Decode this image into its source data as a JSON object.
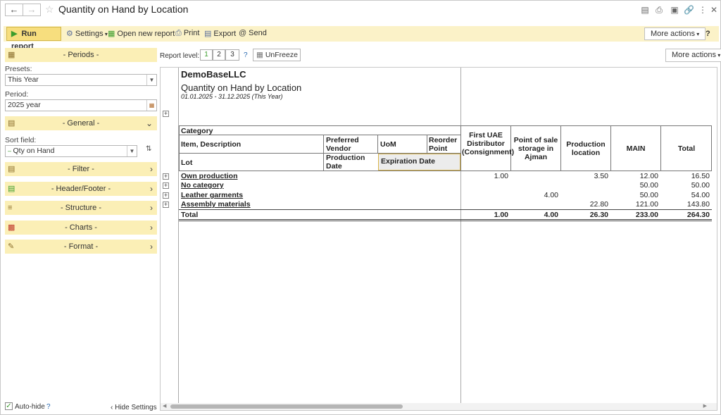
{
  "window": {
    "title": "Quantity on Hand by Location"
  },
  "toolbar": {
    "run_report": "Run report",
    "settings": "Settings",
    "open_new_report": "Open new report",
    "print": "Print",
    "export": "Export",
    "send": "Send",
    "more_actions": "More actions",
    "help": "?"
  },
  "settings_panel": {
    "periods": "- Periods -",
    "presets_label": "Presets:",
    "presets_value": "This Year",
    "period_label": "Period:",
    "period_value": "2025 year",
    "general": "- General -",
    "sort_field_label": "Sort field:",
    "sort_field_value": "Qty on Hand",
    "filter": "- Filter -",
    "header_footer": "- Header/Footer -",
    "structure": "- Structure -",
    "charts": "- Charts -",
    "format": "- Format -",
    "auto_hide": "Auto-hide",
    "auto_hide_help": "?",
    "hide_settings": "Hide Settings"
  },
  "report_bar": {
    "report_level_label": "Report level:",
    "levels": [
      "1",
      "2",
      "3"
    ],
    "help": "?",
    "unfreeze": "UnFreeze",
    "more_actions": "More actions"
  },
  "report": {
    "company": "DemoBaseLLC",
    "title": "Quantity on Hand by Location",
    "period": "01.01.2025 - 31.12.2025 (This Year)",
    "headers": {
      "category": "Category",
      "item_description": "Item, Description",
      "preferred_vendor": "Preferred Vendor",
      "uom": "UoM",
      "reorder_point": "Reorder Point",
      "lot": "Lot",
      "production_date": "Production Date",
      "expiration_date": "Expiration Date",
      "col1": "First UAE Distributor (Consignment)",
      "col2": "Point of sale storage in Ajman",
      "col3": "Production location",
      "col4": "MAIN",
      "col5": "Total"
    },
    "rows": [
      {
        "name": "Own production",
        "c1": "1.00",
        "c2": "",
        "c3": "3.50",
        "c4": "12.00",
        "c5": "16.50"
      },
      {
        "name": "No category",
        "c1": "",
        "c2": "",
        "c3": "",
        "c4": "50.00",
        "c5": "50.00"
      },
      {
        "name": "Leather garments",
        "c1": "",
        "c2": "4.00",
        "c3": "",
        "c4": "50.00",
        "c5": "54.00"
      },
      {
        "name": "Assembly materials",
        "c1": "",
        "c2": "",
        "c3": "22.80",
        "c4": "121.00",
        "c5": "143.80"
      }
    ],
    "total": {
      "name": "Total",
      "c1": "1.00",
      "c2": "4.00",
      "c3": "26.30",
      "c4": "233.00",
      "c5": "264.30"
    }
  }
}
